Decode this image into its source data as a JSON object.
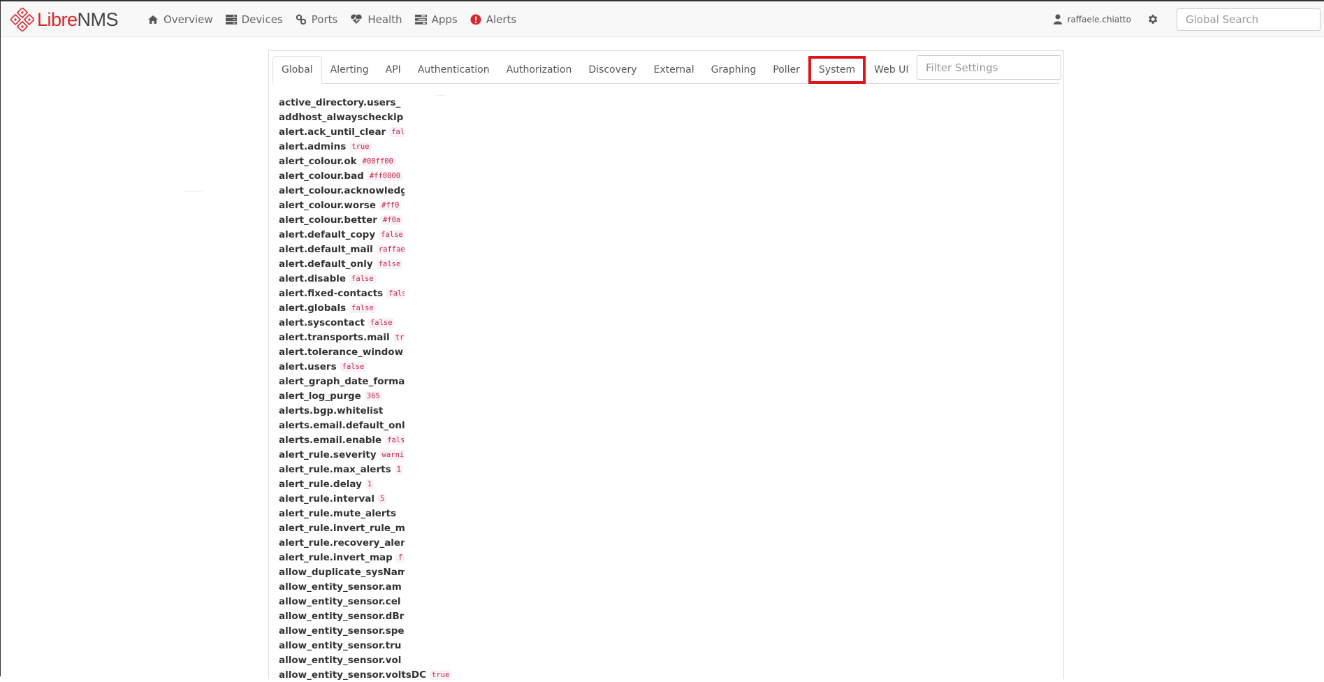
{
  "brand": {
    "libre": "Libre",
    "nms": "NMS"
  },
  "nav": [
    {
      "label": "Overview",
      "icon": "home-icon"
    },
    {
      "label": "Devices",
      "icon": "server-icon"
    },
    {
      "label": "Ports",
      "icon": "link-icon"
    },
    {
      "label": "Health",
      "icon": "heartbeat-icon"
    },
    {
      "label": "Apps",
      "icon": "tasks-icon"
    },
    {
      "label": "Alerts",
      "icon": "exclamation-circle-icon"
    }
  ],
  "user": {
    "name": "raffaele.chiatto"
  },
  "search": {
    "placeholder": "Global Search"
  },
  "tabs": [
    {
      "label": "Global",
      "active": true
    },
    {
      "label": "Alerting"
    },
    {
      "label": "API"
    },
    {
      "label": "Authentication"
    },
    {
      "label": "Authorization"
    },
    {
      "label": "Discovery"
    },
    {
      "label": "External"
    },
    {
      "label": "Graphing"
    },
    {
      "label": "Poller"
    },
    {
      "label": "System",
      "highlighted": true
    },
    {
      "label": "Web UI"
    }
  ],
  "filter": {
    "placeholder": "Filter Settings"
  },
  "colors": {
    "accent": "#d9272e",
    "highlight_box": "#e0151c",
    "value_text": "#c7254e",
    "value_bg": "#f9f2f4"
  },
  "settings": [
    {
      "key": "active_directory.users_",
      "value": ""
    },
    {
      "key": "addhost_alwayscheckip",
      "value": ""
    },
    {
      "key": "alert.ack_until_clear",
      "value": "fal"
    },
    {
      "key": "alert.admins",
      "value": "true"
    },
    {
      "key": "alert_colour.ok",
      "value": "#00ff00"
    },
    {
      "key": "alert_colour.bad",
      "value": "#ff0000"
    },
    {
      "key": "alert_colour.acknowledg",
      "value": ""
    },
    {
      "key": "alert_colour.worse",
      "value": "#ff0"
    },
    {
      "key": "alert_colour.better",
      "value": "#f0a"
    },
    {
      "key": "alert.default_copy",
      "value": "false"
    },
    {
      "key": "alert.default_mail",
      "value": "raffae"
    },
    {
      "key": "alert.default_only",
      "value": "false"
    },
    {
      "key": "alert.disable",
      "value": "false"
    },
    {
      "key": "alert.fixed-contacts",
      "value": "fals"
    },
    {
      "key": "alert.globals",
      "value": "false"
    },
    {
      "key": "alert.syscontact",
      "value": "false"
    },
    {
      "key": "alert.transports.mail",
      "value": "tr"
    },
    {
      "key": "alert.tolerance_window",
      "value": ""
    },
    {
      "key": "alert.users",
      "value": "false"
    },
    {
      "key": "alert_graph_date_forma",
      "value": ""
    },
    {
      "key": "alert_log_purge",
      "value": "365"
    },
    {
      "key": "alerts.bgp.whitelist",
      "value": ""
    },
    {
      "key": "alerts.email.default_onl",
      "value": ""
    },
    {
      "key": "alerts.email.enable",
      "value": "fals"
    },
    {
      "key": "alert_rule.severity",
      "value": "warni"
    },
    {
      "key": "alert_rule.max_alerts",
      "value": "1"
    },
    {
      "key": "alert_rule.delay",
      "value": "1"
    },
    {
      "key": "alert_rule.interval",
      "value": "5"
    },
    {
      "key": "alert_rule.mute_alerts",
      "value": ""
    },
    {
      "key": "alert_rule.invert_rule_m",
      "value": ""
    },
    {
      "key": "alert_rule.recovery_aler",
      "value": ""
    },
    {
      "key": "alert_rule.invert_map",
      "value": "f"
    },
    {
      "key": "allow_duplicate_sysNam",
      "value": ""
    },
    {
      "key": "allow_entity_sensor.am",
      "value": ""
    },
    {
      "key": "allow_entity_sensor.cel",
      "value": ""
    },
    {
      "key": "allow_entity_sensor.dBr",
      "value": ""
    },
    {
      "key": "allow_entity_sensor.spe",
      "value": ""
    },
    {
      "key": "allow_entity_sensor.tru",
      "value": ""
    },
    {
      "key": "allow_entity_sensor.vol",
      "value": ""
    },
    {
      "key": "allow_entity_sensor.voltsDC",
      "value": "true",
      "wide": true
    }
  ]
}
